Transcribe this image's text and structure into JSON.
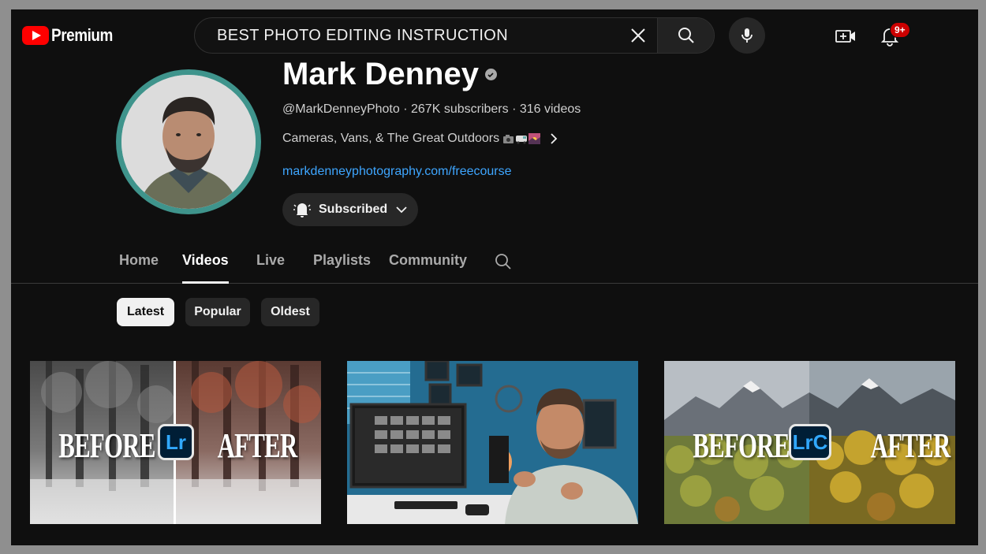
{
  "header": {
    "logo_text": "Premium",
    "search_value": "BEST PHOTO EDITING INSTRUCTION",
    "notification_count": "9+"
  },
  "channel": {
    "name": "Mark Denney",
    "handle": "@MarkDenneyPhoto",
    "subscribers": "267K subscribers",
    "videos": "316 videos",
    "description": "Cameras, Vans, & The Great Outdoors",
    "link": "markdenneyphotography.com/freecourse",
    "subscribe_label": "Subscribed"
  },
  "tabs": [
    {
      "label": "Home",
      "active": false
    },
    {
      "label": "Videos",
      "active": true
    },
    {
      "label": "Live",
      "active": false
    },
    {
      "label": "Playlists",
      "active": false
    },
    {
      "label": "Community",
      "active": false
    }
  ],
  "filters": [
    {
      "label": "Latest",
      "active": true
    },
    {
      "label": "Popular",
      "active": false
    },
    {
      "label": "Oldest",
      "active": false
    }
  ],
  "videos": [
    {
      "before": "BEFORE",
      "after": "AFTER",
      "badge": "Lr"
    },
    {},
    {
      "before": "BEFORE",
      "after": "AFTER",
      "badge": "LrC"
    }
  ],
  "colors": {
    "background": "#0f0f0f",
    "brand_red": "#ff0000",
    "link_blue": "#3ea6ff",
    "avatar_ring": "#3f948c",
    "lightroom_blue": "#31a8ff"
  }
}
